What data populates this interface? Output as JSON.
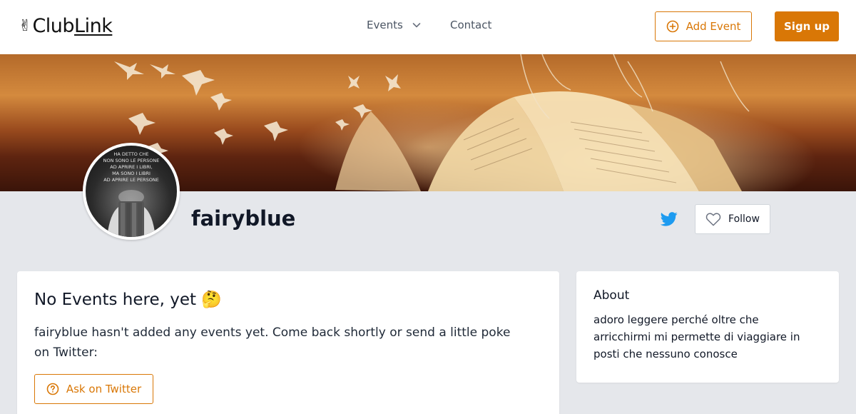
{
  "header": {
    "logo_hand": "✌",
    "logo_text_a": "Club",
    "logo_text_b": "Link",
    "nav_events": "Events",
    "nav_contact": "Contact",
    "add_event_label": "Add Event",
    "signup_label": "Sign up"
  },
  "profile": {
    "name": "fairyblue",
    "avatar_text_lines": [
      "HA DETTO CHE",
      "NON SONO LE PERSONE",
      "AD APRIRE I LIBRI,",
      "MA SONO I LIBRI",
      "AD APRIRE LE PERSONE"
    ],
    "follow_label": "Follow"
  },
  "events_card": {
    "title": "No Events here, yet 🤔",
    "message": "fairyblue hasn't added any events yet. Come back shortly or send a little poke on Twitter:",
    "ask_label": "Ask on Twitter"
  },
  "about_card": {
    "title": "About",
    "text": "adoro leggere perché oltre che arricchirmi mi permette di viaggiare in posti che nessuno conosce"
  },
  "colors": {
    "accent": "#d97706",
    "twitter": "#1d9bf0",
    "background": "#e5e7eb"
  },
  "icons": {
    "add_event": "plus-circle-icon",
    "events_dropdown": "chevron-down-icon",
    "twitter": "twitter-icon",
    "follow": "heart-icon",
    "ask": "question-circle-icon"
  }
}
